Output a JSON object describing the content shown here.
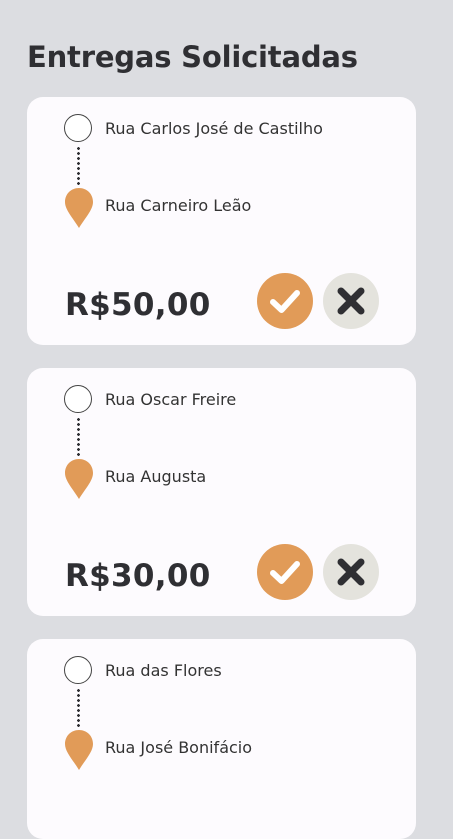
{
  "page": {
    "title": "Entregas Solicitadas"
  },
  "colors": {
    "background": "#dcdde1",
    "card": "#fdfbfe",
    "accent": "#e19b58",
    "reject_bg": "#e4e3dd",
    "text": "#2f2f33"
  },
  "icons": {
    "origin": "circle-outline-icon",
    "destination": "map-pin-icon",
    "accept": "check-icon",
    "reject": "close-icon"
  },
  "deliveries": [
    {
      "from": "Rua Carlos José de Castilho",
      "to": "Rua Carneiro Leão",
      "price": "R$50,00"
    },
    {
      "from": "Rua Oscar Freire",
      "to": "Rua Augusta",
      "price": "R$30,00"
    },
    {
      "from": "Rua das Flores",
      "to": "Rua José Bonifácio",
      "price": ""
    }
  ]
}
